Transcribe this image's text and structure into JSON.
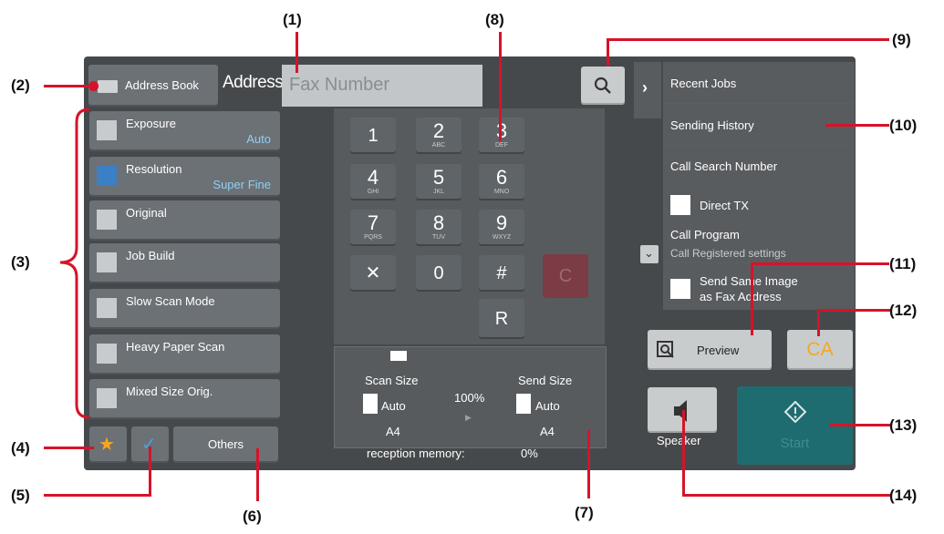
{
  "callouts": [
    "(1)",
    "(2)",
    "(3)",
    "(4)",
    "(5)",
    "(6)",
    "(7)",
    "(8)",
    "(9)",
    "(10)",
    "(11)",
    "(12)",
    "(13)",
    "(14)"
  ],
  "header": {
    "address_book_label": "Address Book",
    "address_label": "Address",
    "fax_number_placeholder": "Fax Number"
  },
  "sidebar": {
    "items": [
      {
        "label": "Exposure",
        "value": "Auto"
      },
      {
        "label": "Resolution",
        "value": "Super Fine"
      },
      {
        "label": "Original",
        "value": ""
      },
      {
        "label": "Job Build",
        "value": ""
      },
      {
        "label": "Slow Scan Mode",
        "value": ""
      },
      {
        "label": "Heavy Paper Scan",
        "value": ""
      },
      {
        "label": "Mixed Size Orig.",
        "value": ""
      }
    ],
    "others_label": "Others"
  },
  "keypad": {
    "keys": [
      {
        "digit": "1",
        "sub": ""
      },
      {
        "digit": "2",
        "sub": "ABC"
      },
      {
        "digit": "3",
        "sub": "DEF"
      },
      {
        "digit": "4",
        "sub": "GHI"
      },
      {
        "digit": "5",
        "sub": "JKL"
      },
      {
        "digit": "6",
        "sub": "MNO"
      },
      {
        "digit": "7",
        "sub": "PQRS"
      },
      {
        "digit": "8",
        "sub": "TUV"
      },
      {
        "digit": "9",
        "sub": "WXYZ"
      },
      {
        "digit": "✕",
        "sub": ""
      },
      {
        "digit": "0",
        "sub": ""
      },
      {
        "digit": "#",
        "sub": ""
      }
    ],
    "clear_label": "C",
    "redial_label": "R"
  },
  "scan_info": {
    "scan_size_label": "Scan Size",
    "send_size_label": "Send Size",
    "scan_size_value": "Auto",
    "send_size_value": "Auto",
    "scan_paper": "A4",
    "send_paper": "A4",
    "ratio": "100%",
    "memory_label": "reception memory:",
    "memory_value": "0%"
  },
  "action_panel": {
    "items": [
      "Recent Jobs",
      "Sending History",
      "Call Search Number",
      "Direct TX",
      "Call Program",
      "Call Registered settings",
      "Send Same Image",
      "as Fax Address"
    ]
  },
  "buttons": {
    "preview_label": "Preview",
    "ca_label": "CA",
    "speaker_label": "Speaker",
    "start_label": "Start"
  },
  "colors": {
    "accent_blue": "#8fd0f2",
    "callout_red": "#d6132a",
    "ca_orange": "#f5a623",
    "start_teal": "#1f6c70"
  }
}
